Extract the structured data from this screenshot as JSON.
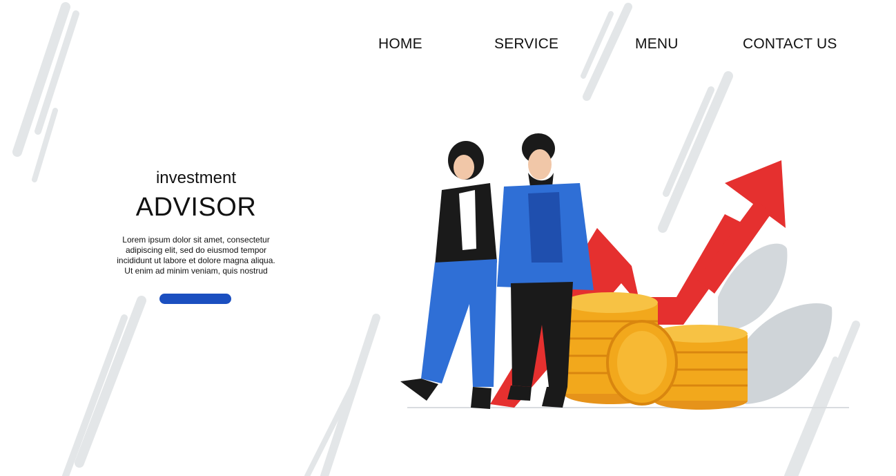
{
  "nav": {
    "items": [
      {
        "label": "HOME"
      },
      {
        "label": "SERVICE"
      },
      {
        "label": "MENU"
      },
      {
        "label": "CONTACT US"
      }
    ]
  },
  "hero": {
    "kicker": "investment",
    "title": "ADVISOR",
    "body": [
      "Lorem ipsum dolor sit amet, consectetur",
      "adipiscing elit, sed do eiusmod tempor",
      "incididunt ut labore et dolore magna aliqua.",
      "Ut enim ad minim veniam, quis nostrud"
    ],
    "cta_color": "#1b4fc0"
  },
  "colors": {
    "arrow": "#e5302f",
    "coin": "#f2a81c",
    "jacket_blue": "#2f6fd6",
    "jacket_black": "#1a1a1a",
    "stripe_gray": "#e4e7e9"
  }
}
